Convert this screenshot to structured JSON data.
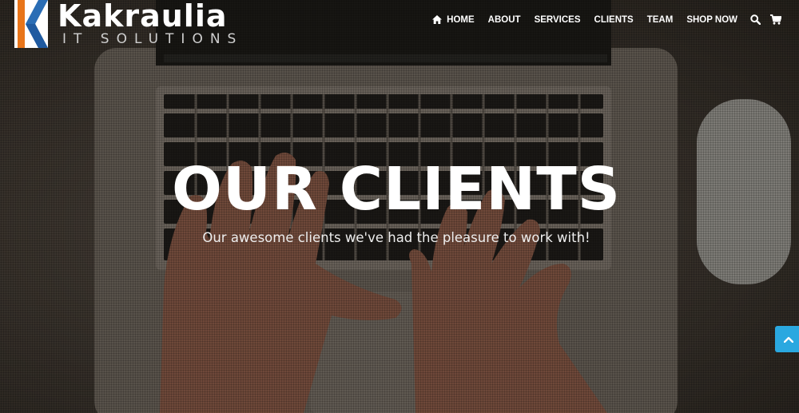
{
  "brand": {
    "name": "Kakraulia",
    "tagline": "IT SOLUTIONS",
    "colors": {
      "orange": "#e8751a",
      "blue": "#2a6db5",
      "white": "#ffffff"
    }
  },
  "nav": {
    "items": [
      {
        "label": "HOME",
        "icon": "home-icon"
      },
      {
        "label": "ABOUT"
      },
      {
        "label": "SERVICES"
      },
      {
        "label": "CLIENTS"
      },
      {
        "label": "TEAM"
      },
      {
        "label": "SHOP NOW"
      }
    ],
    "icons": [
      "search-icon",
      "cart-icon"
    ]
  },
  "hero": {
    "title": "OUR CLIENTS",
    "subtitle": "Our awesome clients we've had the pleasure to work with!"
  },
  "scroll_top": {
    "icon": "chevron-up-icon",
    "color": "#2aa8e0"
  }
}
